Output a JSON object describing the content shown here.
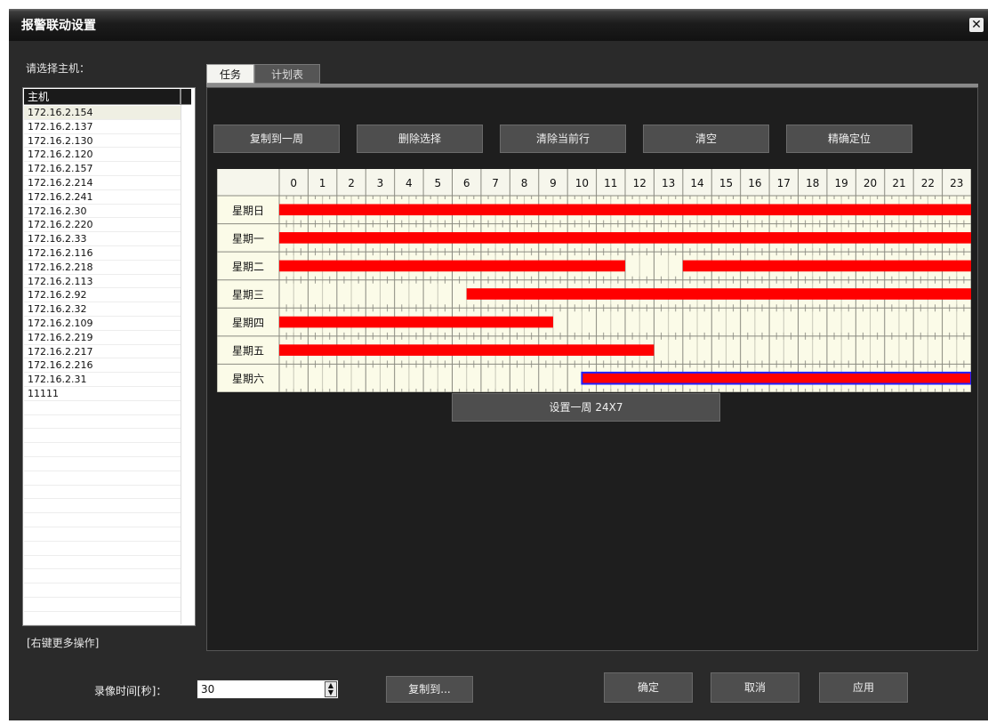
{
  "window": {
    "title": "报警联动设置",
    "close_symbol": "✕"
  },
  "host_select": {
    "label": "请选择主机：",
    "column_header": "主机",
    "selected_index": 0,
    "hosts": [
      "172.16.2.154",
      "172.16.2.137",
      "172.16.2.130",
      "172.16.2.120",
      "172.16.2.157",
      "172.16.2.214",
      "172.16.2.241",
      "172.16.2.30",
      "172.16.2.220",
      "172.16.2.33",
      "172.16.2.116",
      "172.16.2.218",
      "172.16.2.113",
      "172.16.2.92",
      "172.16.2.32",
      "172.16.2.109",
      "172.16.2.219",
      "172.16.2.217",
      "172.16.2.216",
      "172.16.2.31",
      "11111"
    ],
    "hint": "[右键更多操作]"
  },
  "tabs": [
    {
      "label": "任务",
      "active": true
    },
    {
      "label": "计划表",
      "active": false
    }
  ],
  "toolbar": {
    "copy_week": "复制到一周",
    "delete_selection": "删除选择",
    "clear_row": "清除当前行",
    "clear_all": "清空",
    "precise_locate": "精确定位"
  },
  "schedule": {
    "hours": [
      "0",
      "1",
      "2",
      "3",
      "4",
      "5",
      "6",
      "7",
      "8",
      "9",
      "10",
      "11",
      "12",
      "13",
      "14",
      "15",
      "16",
      "17",
      "18",
      "19",
      "20",
      "21",
      "22",
      "23"
    ],
    "days": [
      {
        "label": "星期日",
        "segments": [
          [
            0,
            24
          ]
        ],
        "selected": false
      },
      {
        "label": "星期一",
        "segments": [
          [
            0,
            24
          ]
        ],
        "selected": false
      },
      {
        "label": "星期二",
        "segments": [
          [
            0,
            12
          ],
          [
            14,
            24
          ]
        ],
        "selected": false
      },
      {
        "label": "星期三",
        "segments": [
          [
            6.5,
            24
          ]
        ],
        "selected": false
      },
      {
        "label": "星期四",
        "segments": [
          [
            0,
            9.5
          ]
        ],
        "selected": false
      },
      {
        "label": "星期五",
        "segments": [
          [
            0,
            13
          ]
        ],
        "selected": false
      },
      {
        "label": "星期六",
        "segments": [
          [
            10.5,
            24
          ]
        ],
        "selected": true
      }
    ],
    "colors": {
      "active": "#ff0000",
      "selected_outline": "#2020ff",
      "cell_bg": "#fbfbe8",
      "grid_line": "#8a8a80"
    }
  },
  "set_week_button": "设置一周 24X7",
  "footer": {
    "record_time_label": "录像时间[秒]：",
    "record_time_value": "30",
    "copy_to": "复制到...",
    "ok": "确定",
    "cancel": "取消",
    "apply": "应用"
  }
}
